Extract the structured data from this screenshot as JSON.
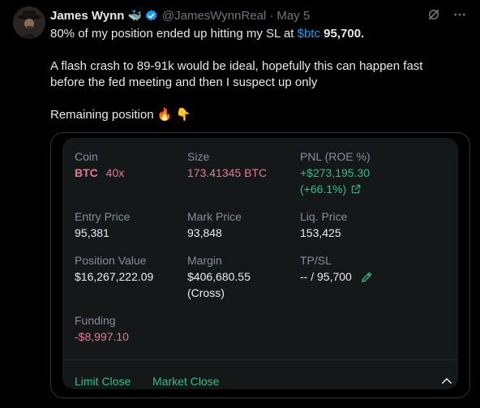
{
  "tweet": {
    "author_name": "James Wynn",
    "author_emoji": "🐳",
    "handle": "@JamesWynnReal",
    "separator": "·",
    "time": "May 5",
    "line1_pre": "80% of my position ended up hitting my SL at ",
    "line1_cashtag": "$btc",
    "line1_bold": " 95,700.",
    "line2a": "A flash crash to 89-91k would be ideal, hopefully this can happen fast",
    "line2b": "before the fed meeting and then I suspect up only",
    "line3": "Remaining position",
    "line3_emojis": "🔥 👇"
  },
  "position": {
    "coin_label": "Coin",
    "coin": "BTC",
    "leverage": "40x",
    "size_label": "Size",
    "size": "173.41345 BTC",
    "pnl_label": "PNL (ROE %)",
    "pnl": "+$273,195.30",
    "roe": "(+66.1%)",
    "entry_label": "Entry Price",
    "entry": "95,381",
    "mark_label": "Mark Price",
    "mark": "93,848",
    "liq_label": "Liq. Price",
    "liq": "153,425",
    "pv_label": "Position Value",
    "pv": "$16,267,222.09",
    "margin_label": "Margin",
    "margin": "$406,680.55",
    "margin_mode": "(Cross)",
    "tpsl_label": "TP/SL",
    "tpsl": "-- / 95,700",
    "funding_label": "Funding",
    "funding": "-$8,997.10",
    "limit_close": "Limit Close",
    "market_close": "Market Close"
  },
  "colors": {
    "accent_link": "#1d9bf0",
    "positive": "#2ebd85",
    "negative": "#e87890"
  }
}
